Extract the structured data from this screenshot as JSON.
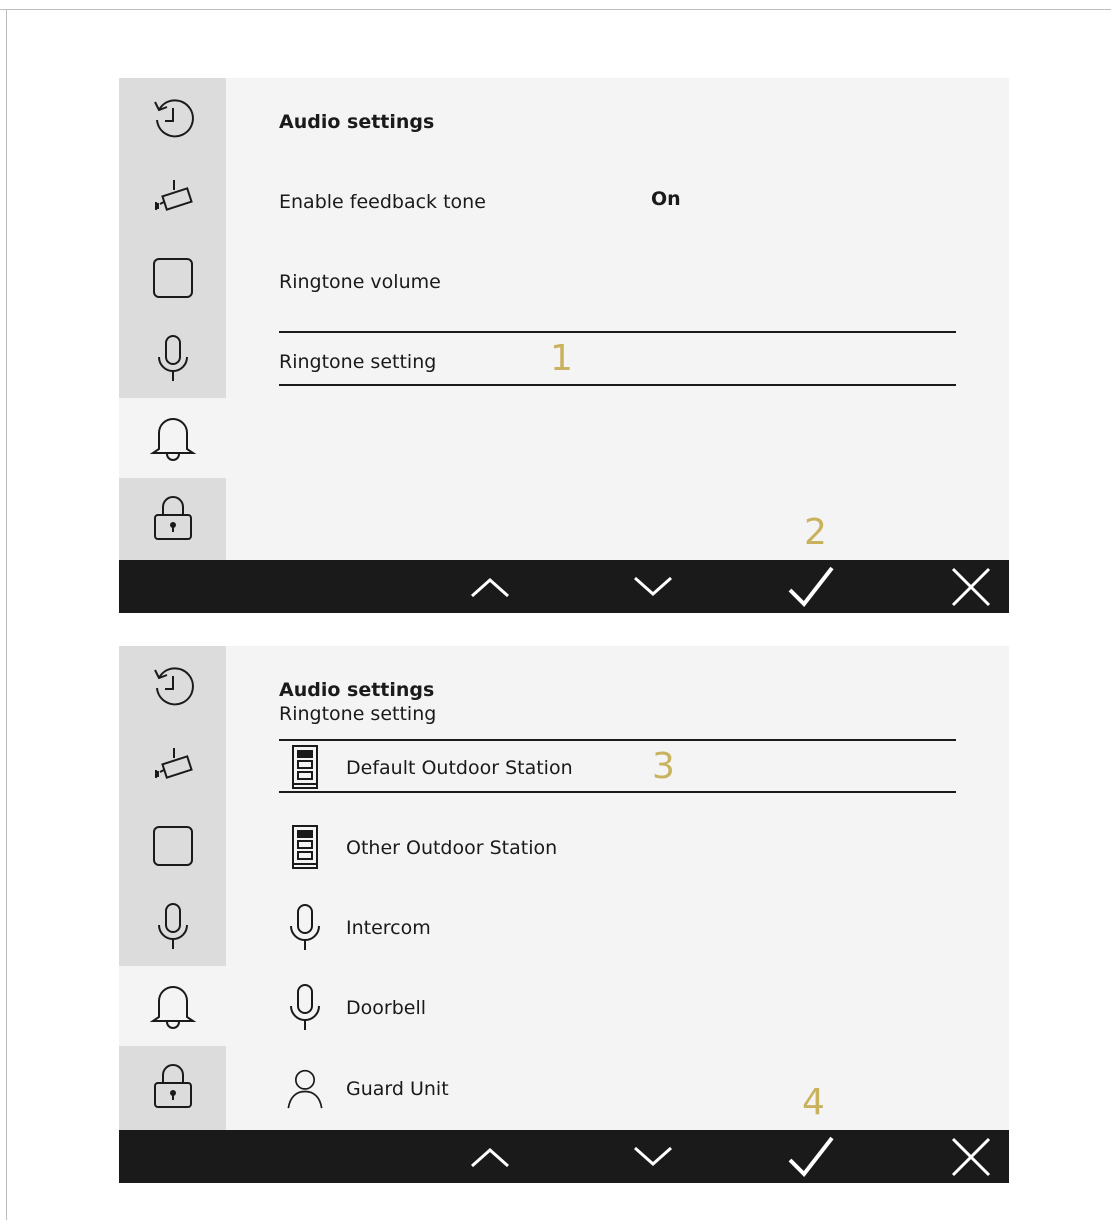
{
  "screen1": {
    "title": "Audio settings",
    "rows": [
      {
        "label": "Enable feedback tone",
        "value": "On"
      },
      {
        "label": "Ringtone volume"
      },
      {
        "label": "Ringtone setting"
      }
    ],
    "markers": [
      "1",
      "2"
    ]
  },
  "screen2": {
    "title": "Audio settings",
    "subtitle": "Ringtone setting",
    "rows": [
      {
        "label": "Default Outdoor Station",
        "icon": "outdoor-station-icon"
      },
      {
        "label": "Other Outdoor Station",
        "icon": "outdoor-station-icon"
      },
      {
        "label": "Intercom",
        "icon": "microphone-icon"
      },
      {
        "label": "Doorbell",
        "icon": "microphone-icon"
      },
      {
        "label": "Guard Unit",
        "icon": "person-icon"
      }
    ],
    "markers": [
      "3",
      "4"
    ]
  },
  "sidebar_icons": [
    "history-icon",
    "camera-icon",
    "square-icon",
    "microphone-icon",
    "bell-icon",
    "lock-icon"
  ],
  "bottombar_icons": [
    "chevron-up-icon",
    "chevron-down-icon",
    "check-icon",
    "close-icon"
  ],
  "colors": {
    "sidebar": "#dcdcdc",
    "content": "#f4f4f4",
    "bar": "#1a1a1a",
    "marker": "#c9b25e"
  }
}
